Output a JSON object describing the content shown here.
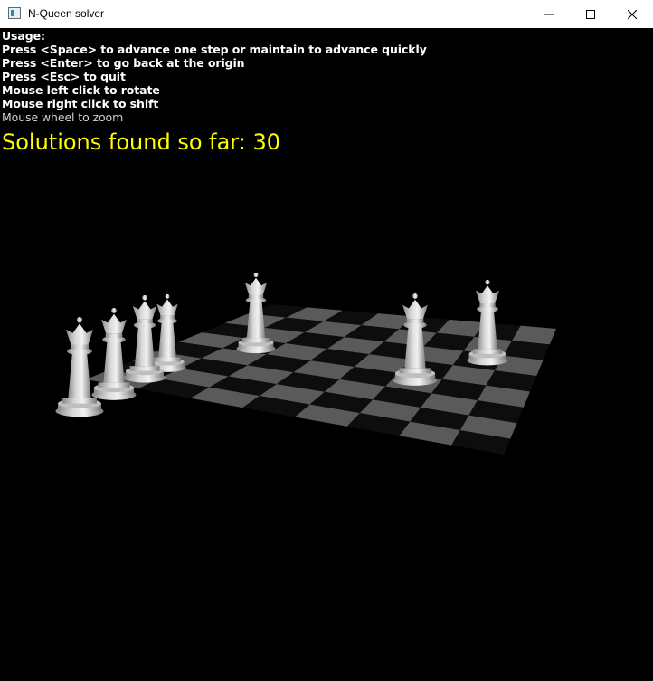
{
  "window": {
    "title": "N-Queen solver",
    "icon": "app-window-icon",
    "controls": {
      "minimize_icon": "minimize-icon",
      "maximize_icon": "maximize-icon",
      "close_icon": "close-icon"
    }
  },
  "overlay": {
    "usage_lines": [
      "Usage:",
      "Press <Space> to advance one step or maintain to advance quickly",
      "Press <Enter> to go back at the origin",
      "Press <Esc> to quit",
      "Mouse left click to rotate",
      "Mouse right click to shift",
      "Mouse wheel to zoom"
    ],
    "solutions_label": "Solutions found so far: 30",
    "solutions_color": "#ffff00"
  },
  "scene": {
    "description_icon": "chessboard-icon",
    "board_size": 8,
    "board_colors": {
      "light": "#5a5a5a",
      "dark": "#0d0d0d"
    },
    "queen_color": "#d8d8d8",
    "queen_icon": "queen-piece-icon",
    "queens_on_board": 3,
    "queens_off_board": 4
  }
}
